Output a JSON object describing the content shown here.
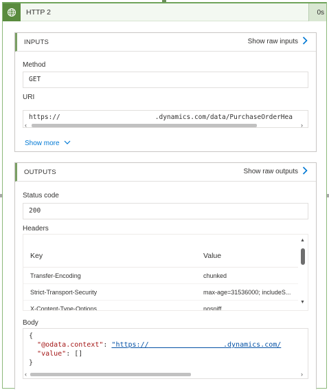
{
  "header": {
    "title": "HTTP 2",
    "duration": "0s",
    "icon": "globe-icon",
    "accent": "#5a8b3e"
  },
  "inputs": {
    "title": "INPUTS",
    "raw_label": "Show raw inputs",
    "method_label": "Method",
    "method_value": "GET",
    "uri_label": "URI",
    "uri_prefix": "https://",
    "uri_suffix": ".dynamics.com/data/PurchaseOrderHea",
    "show_more": "Show more"
  },
  "outputs": {
    "title": "OUTPUTS",
    "raw_label": "Show raw outputs",
    "status_label": "Status code",
    "status_value": "200",
    "headers_label": "Headers",
    "headers_columns": [
      "Key",
      "Value"
    ],
    "headers_rows": [
      {
        "key": "Transfer-Encoding",
        "value": "chunked"
      },
      {
        "key": "Strict-Transport-Security",
        "value": "max-age=31536000; includeS..."
      },
      {
        "key": "X-Content-Type-Options",
        "value": "nosniff"
      }
    ],
    "body_label": "Body",
    "body": {
      "open": "{",
      "key1": "\"@odata.context\"",
      "val1_prefix": "\"https://",
      "val1_suffix": ".dynamics.com/",
      "key2": "\"value\"",
      "val2": "[]",
      "close": "}"
    }
  }
}
